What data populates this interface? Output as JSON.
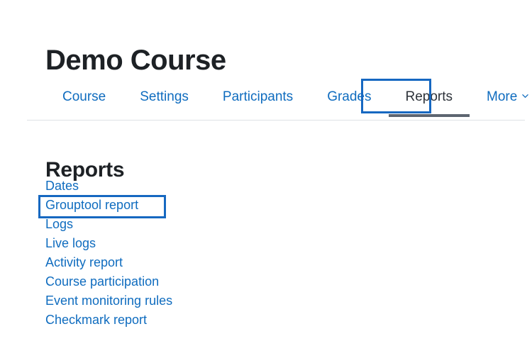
{
  "page": {
    "course_title": "Demo Course",
    "section_heading": "Reports"
  },
  "tabs": [
    {
      "label": "Course",
      "active": false
    },
    {
      "label": "Settings",
      "active": false
    },
    {
      "label": "Participants",
      "active": false
    },
    {
      "label": "Grades",
      "active": false
    },
    {
      "label": "Reports",
      "active": true
    },
    {
      "label": "More",
      "active": false,
      "icon": "chevron-down-icon"
    }
  ],
  "reports": [
    {
      "label": "Dates"
    },
    {
      "label": "Grouptool report"
    },
    {
      "label": "Logs"
    },
    {
      "label": "Live logs"
    },
    {
      "label": "Activity report"
    },
    {
      "label": "Course participation"
    },
    {
      "label": "Event monitoring rules"
    },
    {
      "label": "Checkmark report"
    }
  ],
  "annotations": [
    {
      "name": "reports-tab-highlight",
      "target": "Reports"
    },
    {
      "name": "grouptool-report-highlight",
      "target": "Grouptool report"
    }
  ],
  "colors": {
    "link": "#0f6cbf",
    "active_tab_text": "#2d3239",
    "active_tab_underline": "#5d6570",
    "annotation": "#1668c1",
    "divider": "#dee2e6",
    "heading": "#1d2125",
    "background": "#ffffff"
  }
}
